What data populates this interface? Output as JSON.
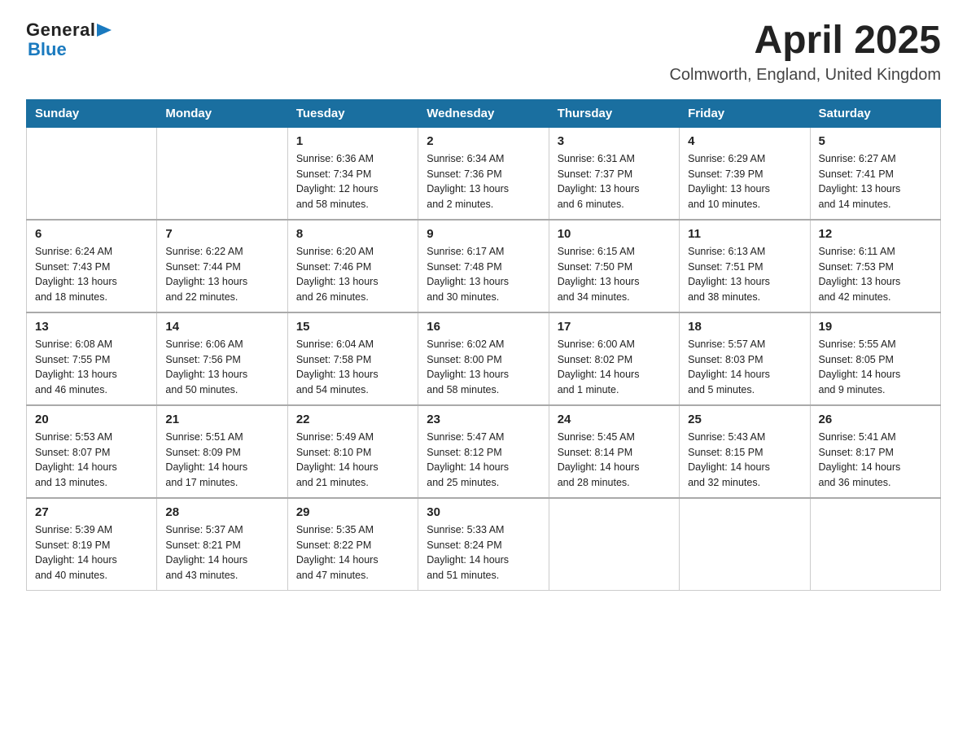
{
  "header": {
    "logo_general": "General",
    "logo_triangle": "▶",
    "logo_blue": "Blue",
    "title": "April 2025",
    "subtitle": "Colmworth, England, United Kingdom"
  },
  "calendar": {
    "columns": [
      "Sunday",
      "Monday",
      "Tuesday",
      "Wednesday",
      "Thursday",
      "Friday",
      "Saturday"
    ],
    "weeks": [
      [
        {
          "day": "",
          "info": ""
        },
        {
          "day": "",
          "info": ""
        },
        {
          "day": "1",
          "info": "Sunrise: 6:36 AM\nSunset: 7:34 PM\nDaylight: 12 hours\nand 58 minutes."
        },
        {
          "day": "2",
          "info": "Sunrise: 6:34 AM\nSunset: 7:36 PM\nDaylight: 13 hours\nand 2 minutes."
        },
        {
          "day": "3",
          "info": "Sunrise: 6:31 AM\nSunset: 7:37 PM\nDaylight: 13 hours\nand 6 minutes."
        },
        {
          "day": "4",
          "info": "Sunrise: 6:29 AM\nSunset: 7:39 PM\nDaylight: 13 hours\nand 10 minutes."
        },
        {
          "day": "5",
          "info": "Sunrise: 6:27 AM\nSunset: 7:41 PM\nDaylight: 13 hours\nand 14 minutes."
        }
      ],
      [
        {
          "day": "6",
          "info": "Sunrise: 6:24 AM\nSunset: 7:43 PM\nDaylight: 13 hours\nand 18 minutes."
        },
        {
          "day": "7",
          "info": "Sunrise: 6:22 AM\nSunset: 7:44 PM\nDaylight: 13 hours\nand 22 minutes."
        },
        {
          "day": "8",
          "info": "Sunrise: 6:20 AM\nSunset: 7:46 PM\nDaylight: 13 hours\nand 26 minutes."
        },
        {
          "day": "9",
          "info": "Sunrise: 6:17 AM\nSunset: 7:48 PM\nDaylight: 13 hours\nand 30 minutes."
        },
        {
          "day": "10",
          "info": "Sunrise: 6:15 AM\nSunset: 7:50 PM\nDaylight: 13 hours\nand 34 minutes."
        },
        {
          "day": "11",
          "info": "Sunrise: 6:13 AM\nSunset: 7:51 PM\nDaylight: 13 hours\nand 38 minutes."
        },
        {
          "day": "12",
          "info": "Sunrise: 6:11 AM\nSunset: 7:53 PM\nDaylight: 13 hours\nand 42 minutes."
        }
      ],
      [
        {
          "day": "13",
          "info": "Sunrise: 6:08 AM\nSunset: 7:55 PM\nDaylight: 13 hours\nand 46 minutes."
        },
        {
          "day": "14",
          "info": "Sunrise: 6:06 AM\nSunset: 7:56 PM\nDaylight: 13 hours\nand 50 minutes."
        },
        {
          "day": "15",
          "info": "Sunrise: 6:04 AM\nSunset: 7:58 PM\nDaylight: 13 hours\nand 54 minutes."
        },
        {
          "day": "16",
          "info": "Sunrise: 6:02 AM\nSunset: 8:00 PM\nDaylight: 13 hours\nand 58 minutes."
        },
        {
          "day": "17",
          "info": "Sunrise: 6:00 AM\nSunset: 8:02 PM\nDaylight: 14 hours\nand 1 minute."
        },
        {
          "day": "18",
          "info": "Sunrise: 5:57 AM\nSunset: 8:03 PM\nDaylight: 14 hours\nand 5 minutes."
        },
        {
          "day": "19",
          "info": "Sunrise: 5:55 AM\nSunset: 8:05 PM\nDaylight: 14 hours\nand 9 minutes."
        }
      ],
      [
        {
          "day": "20",
          "info": "Sunrise: 5:53 AM\nSunset: 8:07 PM\nDaylight: 14 hours\nand 13 minutes."
        },
        {
          "day": "21",
          "info": "Sunrise: 5:51 AM\nSunset: 8:09 PM\nDaylight: 14 hours\nand 17 minutes."
        },
        {
          "day": "22",
          "info": "Sunrise: 5:49 AM\nSunset: 8:10 PM\nDaylight: 14 hours\nand 21 minutes."
        },
        {
          "day": "23",
          "info": "Sunrise: 5:47 AM\nSunset: 8:12 PM\nDaylight: 14 hours\nand 25 minutes."
        },
        {
          "day": "24",
          "info": "Sunrise: 5:45 AM\nSunset: 8:14 PM\nDaylight: 14 hours\nand 28 minutes."
        },
        {
          "day": "25",
          "info": "Sunrise: 5:43 AM\nSunset: 8:15 PM\nDaylight: 14 hours\nand 32 minutes."
        },
        {
          "day": "26",
          "info": "Sunrise: 5:41 AM\nSunset: 8:17 PM\nDaylight: 14 hours\nand 36 minutes."
        }
      ],
      [
        {
          "day": "27",
          "info": "Sunrise: 5:39 AM\nSunset: 8:19 PM\nDaylight: 14 hours\nand 40 minutes."
        },
        {
          "day": "28",
          "info": "Sunrise: 5:37 AM\nSunset: 8:21 PM\nDaylight: 14 hours\nand 43 minutes."
        },
        {
          "day": "29",
          "info": "Sunrise: 5:35 AM\nSunset: 8:22 PM\nDaylight: 14 hours\nand 47 minutes."
        },
        {
          "day": "30",
          "info": "Sunrise: 5:33 AM\nSunset: 8:24 PM\nDaylight: 14 hours\nand 51 minutes."
        },
        {
          "day": "",
          "info": ""
        },
        {
          "day": "",
          "info": ""
        },
        {
          "day": "",
          "info": ""
        }
      ]
    ]
  }
}
